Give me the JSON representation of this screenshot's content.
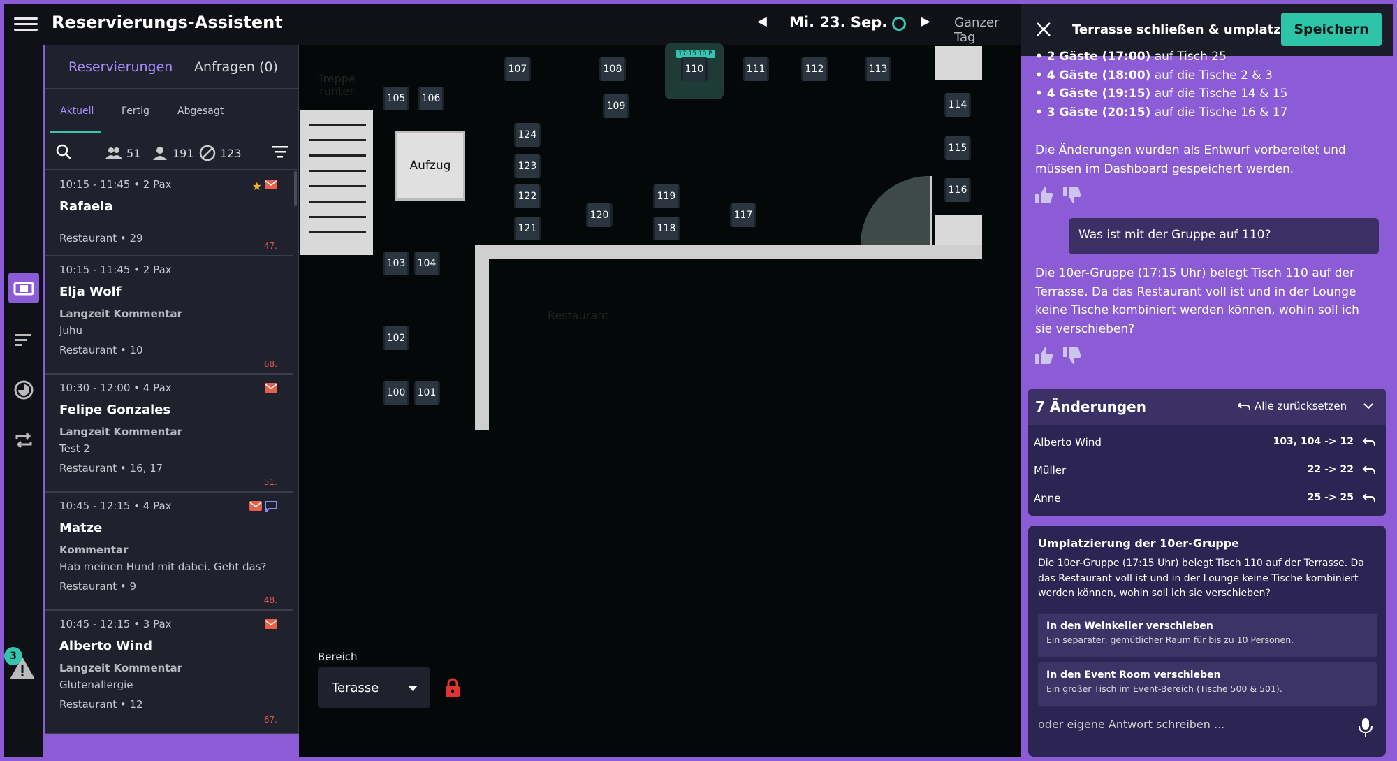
{
  "header": {
    "title": "Reservierungs-Assistent",
    "date": "Mi. 23. Sep.",
    "range": "Ganzer Tag"
  },
  "reservations": {
    "tabs": [
      "Reservierungen",
      "Anfragen (0)"
    ],
    "subtabs": [
      "Aktuell",
      "Fertig",
      "Abgesagt"
    ],
    "filters": {
      "groups": "51",
      "persons": "191",
      "cancelled": "123"
    },
    "items": [
      {
        "time": "10:15 - 11:45 • 2 Pax",
        "name": "Rafaela",
        "label": "",
        "text": "",
        "location": "Restaurant • 29",
        "num": "47."
      },
      {
        "time": "10:15 - 11:45 • 2 Pax",
        "name": "Elja Wolf",
        "label": "Langzeit Kommentar",
        "text": "Juhu",
        "location": "Restaurant • 10",
        "num": "68."
      },
      {
        "time": "10:30 - 12:00 • 4 Pax",
        "name": "Felipe Gonzales",
        "label": "Langzeit Kommentar",
        "text": "Test 2",
        "location": "Restaurant • 16, 17",
        "num": "51."
      },
      {
        "time": "10:45 - 12:15 • 4 Pax",
        "name": "Matze",
        "label": "Kommentar",
        "text": "Hab meinen Hund mit dabei. Geht das?",
        "location": "Restaurant • 9",
        "num": "48."
      },
      {
        "time": "10:45 - 12:15 • 3 Pax",
        "name": "Alberto Wind",
        "label": "Langzeit Kommentar",
        "text": "Glutenallergie",
        "location": "Restaurant • 12",
        "num": "67."
      }
    ]
  },
  "floor": {
    "tables": [
      "100",
      "101",
      "102",
      "103",
      "104",
      "105",
      "106",
      "107",
      "108",
      "109",
      "110",
      "111",
      "112",
      "113",
      "114",
      "115",
      "116",
      "117",
      "118",
      "119",
      "120",
      "121",
      "122",
      "123",
      "124"
    ],
    "selected_tag": "17:15 10 P.",
    "elevator": "Aufzug",
    "stairs": "Treppe runter",
    "area_name": "Restaurant",
    "area_label": "Bereich",
    "area_value": "Terasse"
  },
  "warnings_count": "3",
  "assistant": {
    "title": "Terrasse schließen & umplatzie...",
    "save": "Speichern",
    "moves": [
      {
        "bold": "• 2 Gäste (17:00)",
        "rest": " auf Tisch 25"
      },
      {
        "bold": "• 4 Gäste (18:00)",
        "rest": " auf die Tische 2 & 3"
      },
      {
        "bold": "• 4 Gäste (19:15)",
        "rest": " auf die Tische 14 & 15"
      },
      {
        "bold": "• 3 Gäste (20:15)",
        "rest": " auf die Tische 16 & 17"
      }
    ],
    "draft_note": "Die Änderungen wurden als Entwurf vorbereitet und müssen im Dashboard gespeichert werden.",
    "user_msg": "Was ist mit der Gruppe auf 110?",
    "reply": "Die 10er-Gruppe (17:15 Uhr) belegt Tisch 110 auf der Terrasse. Da das Restaurant voll ist und in der Lounge keine Tische kombiniert werden können, wohin soll ich sie verschieben?",
    "changes_title": "7 Änderungen",
    "reset_all": "Alle zurücksetzen",
    "changes": [
      {
        "name": "Alberto Wind",
        "value": "103, 104 -> 12"
      },
      {
        "name": "Müller",
        "value": "22 -> 22"
      },
      {
        "name": "Anne",
        "value": "25 -> 25"
      }
    ],
    "card_title": "Umplatzierung der 10er-Gruppe",
    "card_text": "Die 10er-Gruppe (17:15 Uhr) belegt Tisch 110 auf der Terrasse. Da das Restaurant voll ist und in der Lounge keine Tische kombiniert werden können, wohin soll ich sie verschieben?",
    "options": [
      {
        "title": "In den Weinkeller verschieben",
        "desc": "Ein separater, gemütlicher Raum für bis zu 10 Personen."
      },
      {
        "title": "In den Event Room verschieben",
        "desc": "Ein großer Tisch im Event-Bereich (Tische 500 & 501)."
      }
    ],
    "input_placeholder": "oder eigene Antwort schreiben ..."
  },
  "colors": {
    "accent": "#8b5cd6",
    "teal": "#2ec4a9",
    "panel": "#1f222d",
    "alert": "#e05757"
  }
}
